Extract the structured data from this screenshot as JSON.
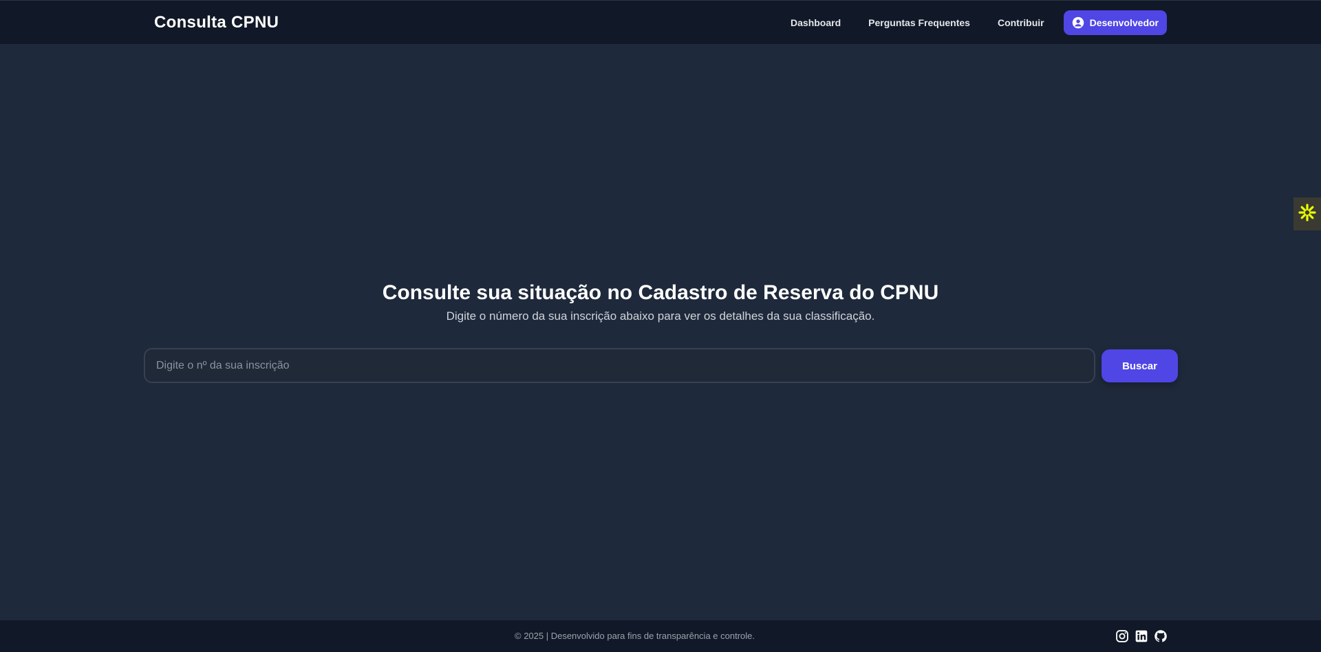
{
  "header": {
    "brand": "Consulta CPNU",
    "nav": {
      "dashboard": "Dashboard",
      "faq": "Perguntas Frequentes",
      "contribute": "Contribuir",
      "developer": "Desenvolvedor"
    }
  },
  "hero": {
    "title": "Consulte sua situação no Cadastro de Reserva do CPNU",
    "subtitle": "Digite o número da sua inscrição abaixo para ver os detalhes da sua classificação."
  },
  "search": {
    "placeholder": "Digite o nº da sua inscrição",
    "value": "",
    "button_label": "Buscar"
  },
  "footer": {
    "text": "© 2025 | Desenvolvido para fins de transparência e controle.",
    "social_icons": [
      "instagram-icon",
      "linkedin-icon",
      "github-icon"
    ]
  },
  "colors": {
    "background": "#1e293b",
    "header_footer": "#111827",
    "accent": "#4f46e5",
    "widget_icon": "#eaff00"
  }
}
